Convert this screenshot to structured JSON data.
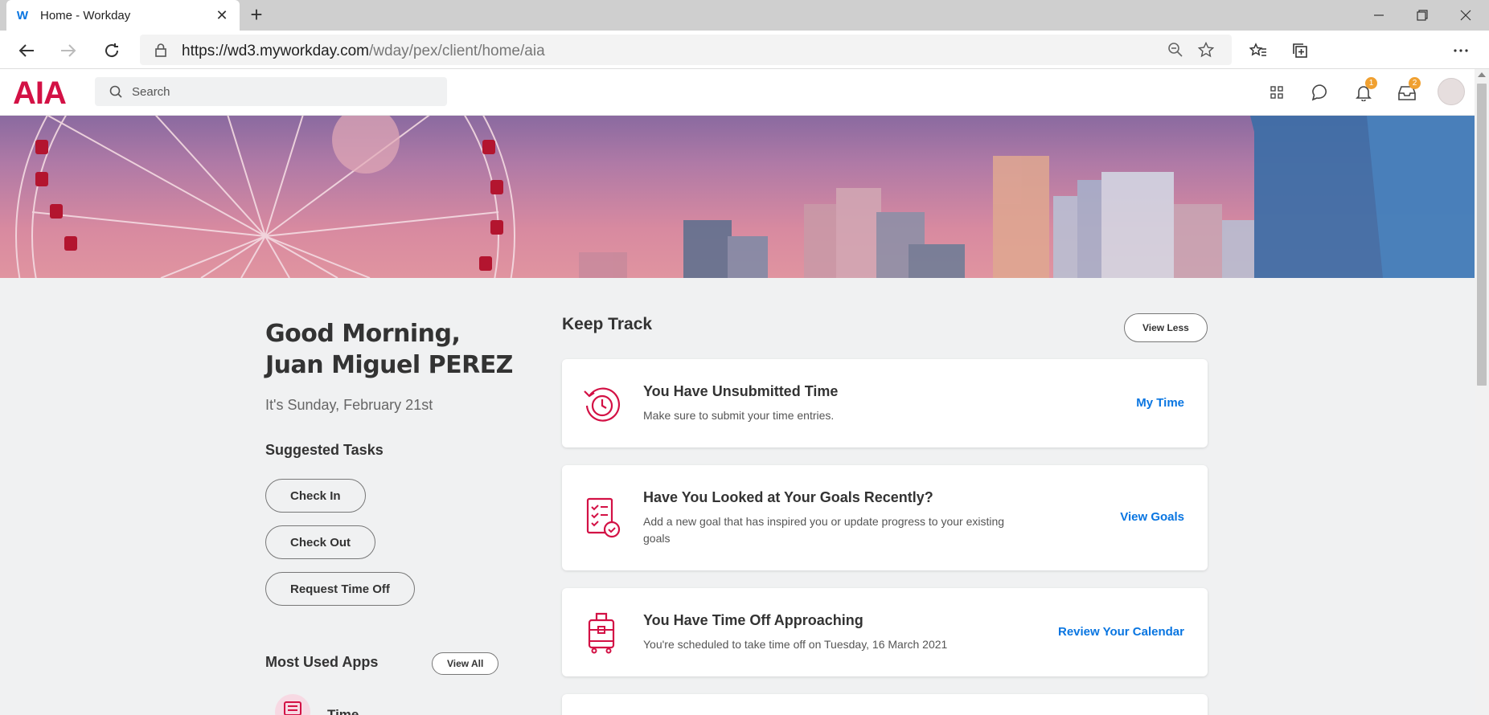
{
  "browser": {
    "tab_title": "Home - Workday",
    "favicon_letter": "W",
    "url_host": "https://wd3.myworkday.com",
    "url_path": "/wday/pex/client/home/aia"
  },
  "header": {
    "logo_text": "AIA",
    "search_placeholder": "Search",
    "notifications_count": "1",
    "inbox_count": "2"
  },
  "greeting": {
    "line1": "Good Morning,",
    "line2": "Juan Miguel PEREZ",
    "date": "It's Sunday, February 21st"
  },
  "suggested_tasks": {
    "heading": "Suggested Tasks",
    "items": [
      "Check In",
      "Check Out",
      "Request Time Off"
    ]
  },
  "most_used_apps": {
    "heading": "Most Used Apps",
    "view_all": "View All",
    "first_app": "Time"
  },
  "keep_track": {
    "heading": "Keep Track",
    "view_less": "View Less",
    "cards": [
      {
        "icon": "time-clock-icon",
        "title": "You Have Unsubmitted Time",
        "desc": "Make sure to submit your time entries.",
        "link": "My Time"
      },
      {
        "icon": "goals-checklist-icon",
        "title": "Have You Looked at Your Goals Recently?",
        "desc": "Add a new goal that has inspired you or update progress to your existing goals",
        "link": "View Goals"
      },
      {
        "icon": "luggage-icon",
        "title": "You Have Time Off Approaching",
        "desc": "You're scheduled to take time off on Tuesday, 16 March 2021",
        "link": "Review Your Calendar"
      }
    ]
  },
  "colors": {
    "brand": "#d31145",
    "link": "#0875e1",
    "badge": "#f0a030",
    "background": "#f0f1f2"
  }
}
